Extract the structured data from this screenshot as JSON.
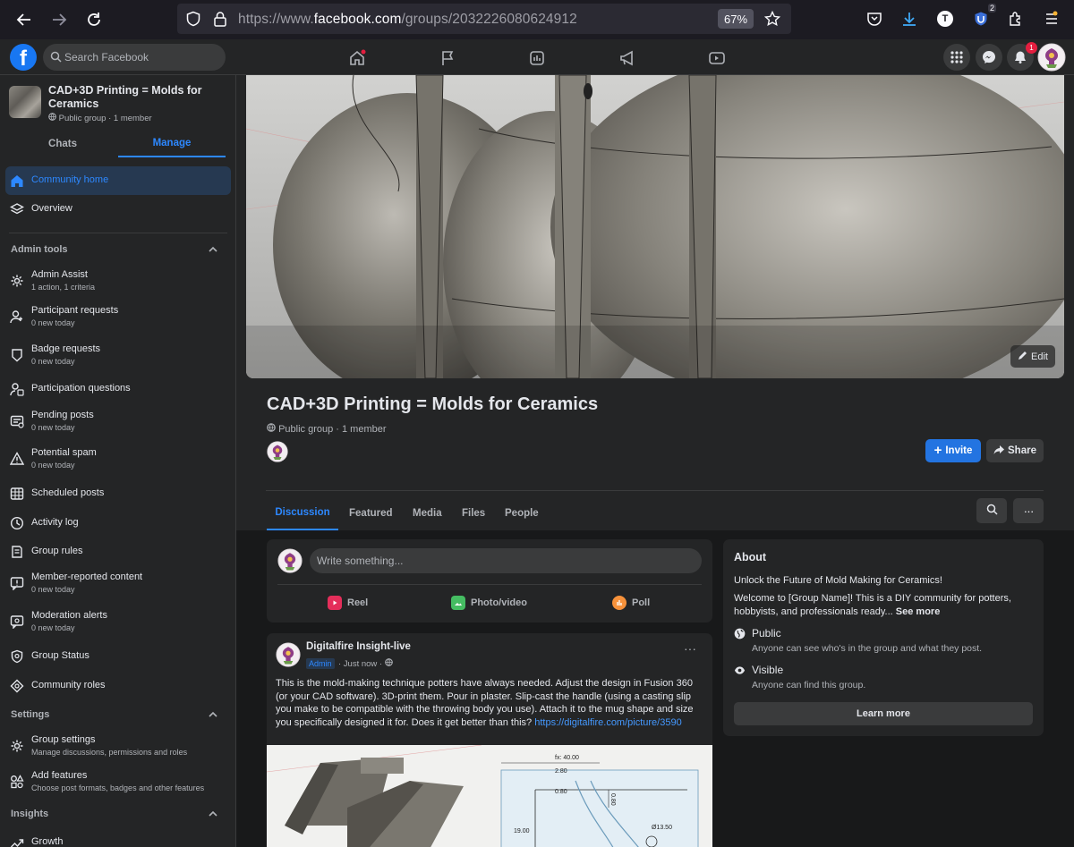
{
  "browser": {
    "url_prefix": "https://www.",
    "url_host": "facebook.com",
    "url_path": "/groups/2032226080624912",
    "zoom": "67%",
    "profile_letter": "T",
    "extension_badge": "2"
  },
  "fb": {
    "search_placeholder": "Search Facebook",
    "notif_count": "1"
  },
  "sidebar": {
    "group_name": "CAD+3D Printing = Molds for Ceramics",
    "group_meta": "Public group · 1 member",
    "tabs": [
      "Chats",
      "Manage"
    ],
    "items_top": [
      {
        "label": "Community home"
      },
      {
        "label": "Overview"
      }
    ],
    "admin_tools_heading": "Admin tools",
    "admin_items": [
      {
        "label": "Admin Assist",
        "sub": "1 action, 1 criteria"
      },
      {
        "label": "Participant requests",
        "sub": "0 new today"
      },
      {
        "label": "Badge requests",
        "sub": "0 new today"
      },
      {
        "label": "Participation questions",
        "sub": ""
      },
      {
        "label": "Pending posts",
        "sub": "0 new today"
      },
      {
        "label": "Potential spam",
        "sub": "0 new today"
      },
      {
        "label": "Scheduled posts",
        "sub": ""
      },
      {
        "label": "Activity log",
        "sub": ""
      },
      {
        "label": "Group rules",
        "sub": ""
      },
      {
        "label": "Member-reported content",
        "sub": "0 new today"
      },
      {
        "label": "Moderation alerts",
        "sub": "0 new today"
      },
      {
        "label": "Group Status",
        "sub": ""
      },
      {
        "label": "Community roles",
        "sub": ""
      }
    ],
    "settings_heading": "Settings",
    "settings_items": [
      {
        "label": "Group settings",
        "sub": "Manage discussions, permissions and roles"
      },
      {
        "label": "Add features",
        "sub": "Choose post formats, badges and other features"
      }
    ],
    "insights_heading": "Insights",
    "insights_items": [
      {
        "label": "Growth"
      }
    ]
  },
  "group": {
    "title": "CAD+3D Printing = Molds for Ceramics",
    "meta": "Public group · 1 member",
    "edit_label": "Edit",
    "invite_label": "Invite",
    "share_label": "Share",
    "tabs": [
      "Discussion",
      "Featured",
      "Media",
      "Files",
      "People"
    ]
  },
  "composer": {
    "placeholder": "Write something...",
    "actions": [
      "Reel",
      "Photo/video",
      "Poll"
    ]
  },
  "post": {
    "author": "Digitalfire Insight-live",
    "badge": "Admin",
    "time": "· Just now ·",
    "body": "This is the mold-making technique potters have always needed. Adjust the design in Fusion 360 (or your CAD software). 3D-print them. Pour in plaster. Slip-cast the handle (using a casting slip you make to be compatible with the throwing body you use). Attach it to the mug shape and size you specifically designed it for. Does it get better than this? ",
    "link": "https://​digitalfire.com/picture/3590",
    "drawing_labels": [
      "fx: 40.00",
      "2.80",
      "0.80",
      "0.80",
      "19.00",
      "Ø13.50"
    ]
  },
  "about": {
    "title": "About",
    "tagline": "Unlock the Future of Mold Making for Ceramics!",
    "desc": "Welcome to [Group Name]! This is a DIY community for potters, hobbyists, and professionals ready...",
    "see_more": "See more",
    "public_title": "Public",
    "public_desc": "Anyone can see who's in the group and what they post.",
    "visible_title": "Visible",
    "visible_desc": "Anyone can find this group.",
    "learn_more": "Learn more"
  },
  "colors": {
    "accent": "#2d88ff",
    "fb_blue": "#1877f2",
    "bg": "#18191a",
    "card": "#242526"
  }
}
